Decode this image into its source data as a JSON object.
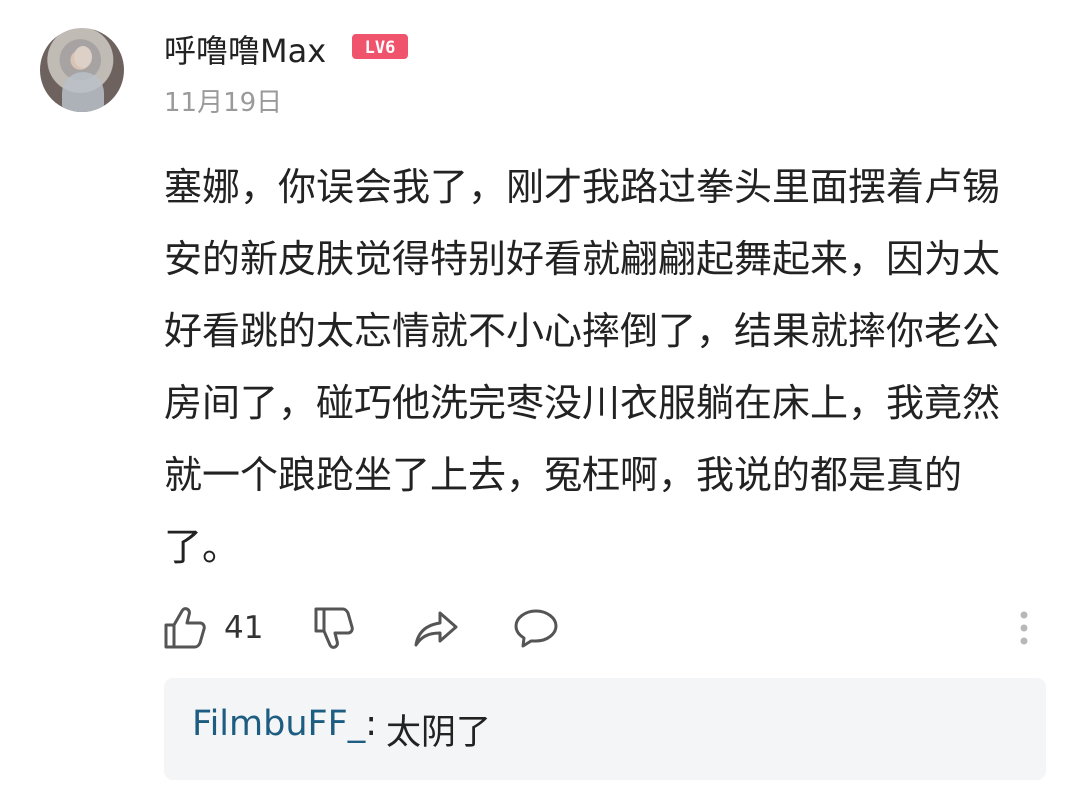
{
  "header": {
    "username": "呼噜噜Max",
    "level_badge": "LV6",
    "date": "11月19日"
  },
  "comment": {
    "lines": [
      "塞娜，你误会我了，刚才我路过拳头里面摆着卢锡",
      "安的新皮肤觉得特别好看就翩翩起舞起来，因为太",
      "好看跳的太忘情就不小心摔倒了，结果就摔你老公",
      "房间了，碰巧他洗完枣没川衣服躺在床上，我竟然",
      "就一个踉跄坐了上去，冤枉啊，我说的都是真的",
      "了。"
    ]
  },
  "actions": {
    "like_count": "41",
    "icons": [
      "thumbs-up-icon",
      "thumbs-down-icon",
      "share-icon",
      "comment-icon",
      "more-vertical-icon"
    ]
  },
  "reply": {
    "author": "FilmbuFF_",
    "separator": ":",
    "text": "太阴了"
  },
  "colors": {
    "accent": "#f0536c",
    "reply_author": "#1e5d82",
    "secondary_text": "#9a9a9a",
    "reply_background": "#f4f5f7"
  }
}
